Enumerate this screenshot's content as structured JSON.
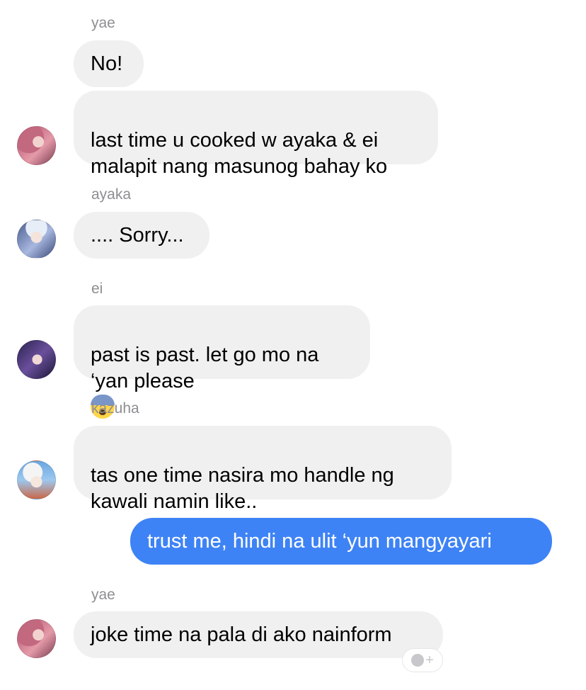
{
  "messages": [
    {
      "sender": "yae",
      "bubbles": [
        "No!",
        "last time u cooked w ayaka & ei\nmalapit nang masunog bahay ko"
      ]
    },
    {
      "sender": "ayaka",
      "bubbles": [
        ".... Sorry..."
      ]
    },
    {
      "sender": "ei",
      "bubbles": [
        "past is past. let go mo na\n‘yan please"
      ],
      "emoji": "anxious-face-emoji"
    },
    {
      "sender": "kazuha",
      "bubbles": [
        "tas one time nasira mo handle ng\nkawali namin like.."
      ]
    },
    {
      "sender": "me",
      "bubbles": [
        "trust me, hindi na ulit ‘yun mangyayari"
      ]
    },
    {
      "sender": "yae",
      "bubbles": [
        "joke time na pala di ako nainform"
      ]
    }
  ],
  "react_button": {
    "icon": "smiley-plus-icon",
    "plus": "+"
  },
  "colors": {
    "my_bubble": "#3e83f5",
    "their_bubble": "#f0f0f0",
    "sender_name": "#8e8e93"
  }
}
